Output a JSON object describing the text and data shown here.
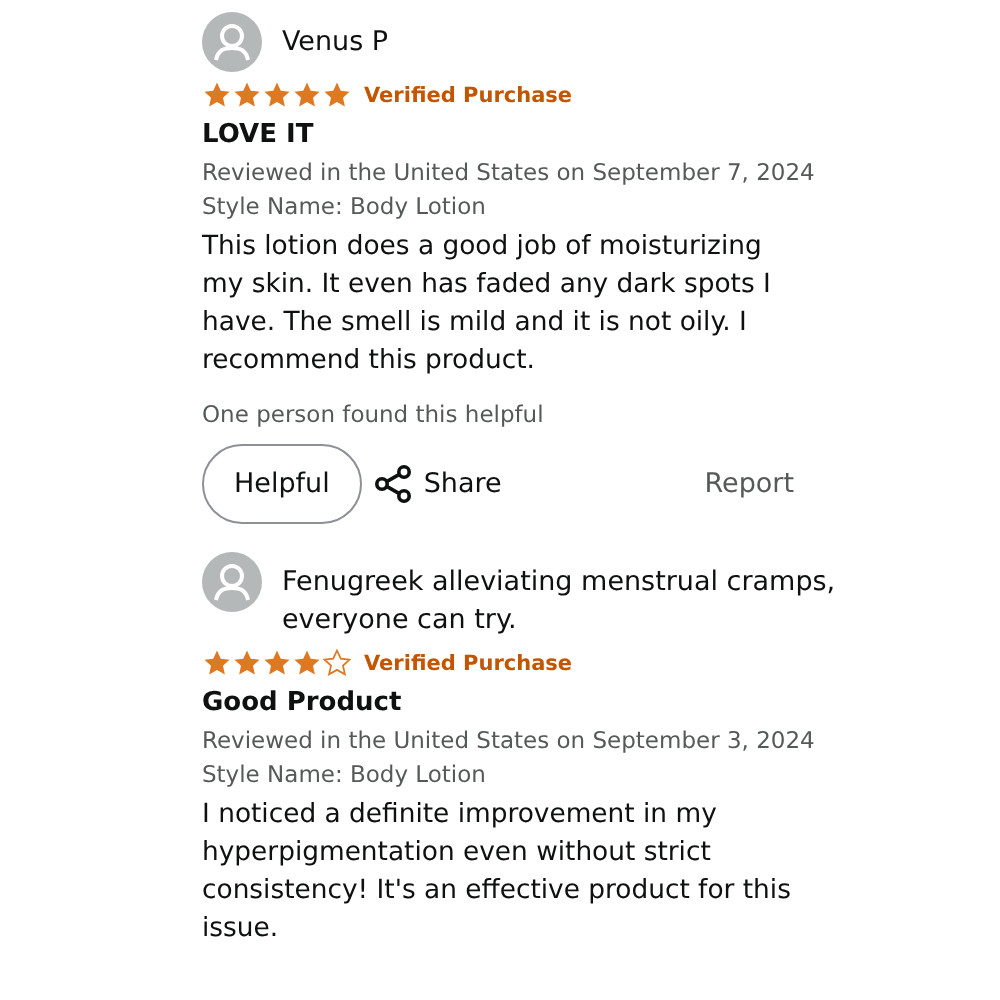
{
  "reviews": [
    {
      "author": "Venus P",
      "stars": 5,
      "badge": "Verified Purchase",
      "title": "LOVE IT",
      "date": "Reviewed in the United States on September 7, 2024",
      "style": "Style Name: Body Lotion",
      "body": "This lotion does a good job of moisturizing my skin. It even has faded any dark spots I have. The smell is mild and it is not oily. I recommend this product.",
      "helpful_count": "One person found this helpful",
      "actions": {
        "helpful": "Helpful",
        "share": "Share",
        "report": "Report"
      }
    },
    {
      "author": "Fenugreek alleviating menstrual cramps, everyone can try.",
      "stars": 4,
      "badge": "Verified Purchase",
      "title": "Good Product",
      "date": "Reviewed in the United States on September 3, 2024",
      "style": "Style Name: Body Lotion",
      "body": "I noticed a definite improvement in my hyperpigmentation even without strict consistency! It's an effective product for this issue."
    }
  ]
}
